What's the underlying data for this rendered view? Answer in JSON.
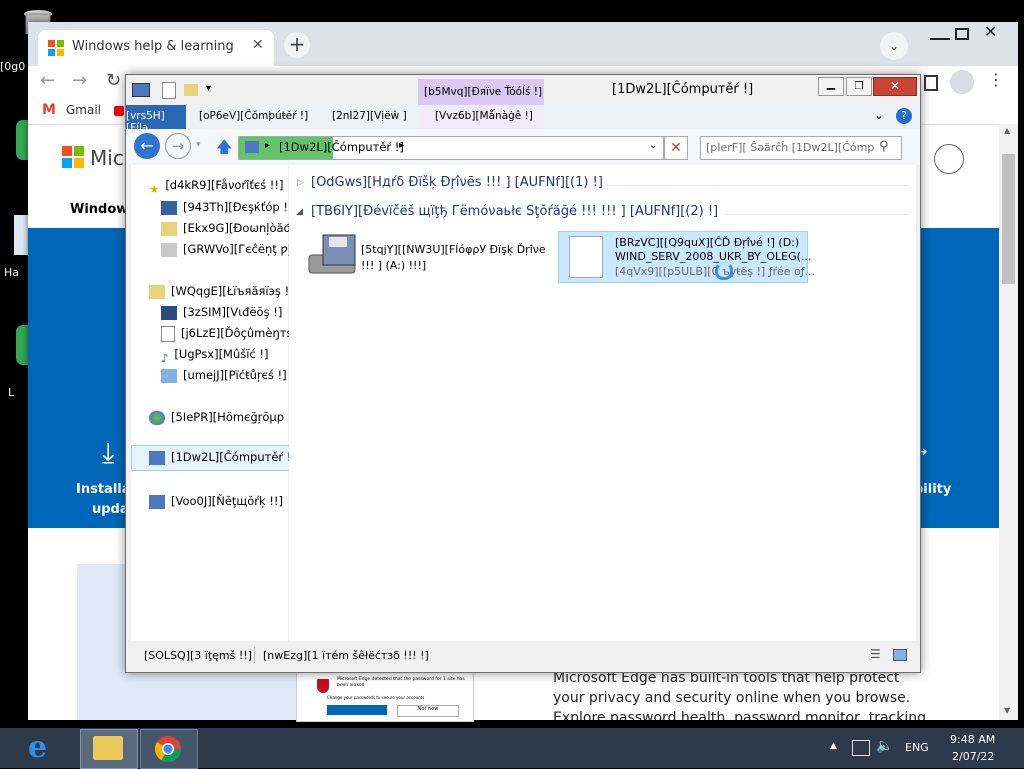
{
  "desktop": {
    "left_labels": [
      "[0g0",
      "Ha",
      "L"
    ]
  },
  "chrome": {
    "tab_title": "Windows help & learning",
    "bookmarks": [
      {
        "label": "Gmail"
      }
    ],
    "page": {
      "brand_partial": "Micr",
      "nav_partial": "Windows",
      "install_line1": "Installat",
      "install_line2": "upda",
      "right_tile": "bility",
      "edge_text": "Microsoft Edge has built-in tools that help protect your privacy and security online when you browse. Explore password health, password monitor, tracking prevention,",
      "edge_thumb_title": "Microsoft Edge detected that the password for 1 site has been leaked",
      "edge_thumb_sub": "Change your passwords to secure your accounts",
      "edge_thumb_btn": "Not now"
    }
  },
  "explorer": {
    "title": "[1Dw2L][Ĉómpuтěŕ !]",
    "ribbon_tabs": [
      {
        "label": "[vrs5H][Fíl϶"
      },
      {
        "label": "[oP6eV][Ĉŏmþúŧĕŕ !]"
      },
      {
        "label": "[2nI27][Vịëŵ ]"
      },
      {
        "label": "[Vvz6b][Mǻnàġê !]"
      }
    ],
    "contextual_tab_group": "[b5Mvq][Ðяïνе Ťóóĺś !]",
    "address": "[1Dw2L][Ĉómpuтěŕ !]",
    "search_placeholder": "[pIerF][ Ŝəărĉĥ [1Dw2L][Ĉómp...",
    "nav": {
      "favorites": "[d4kR9][Fåνоŕîťєś !!]",
      "desktop": "[943Th][Ðєşќťóp !]",
      "downloads": "[Ekx9G][Ðоωnļòăđş",
      "recent": "[GRWVo][Гєĉёņţ ƿļ",
      "libraries": "[WQqgE][Łïъяăяïэş !!]",
      "videos": "[3zSIM][Vιđёŏş !]",
      "documents": "[j6LzE][Ďôçûmèŋтś !",
      "music": "[UgPsx][Mûšïć !]",
      "pictures": "[umejJ][Pїćŧůŗєś !]",
      "homegroup": "[5IePR][Hŏmєğŗŏμр !!]",
      "computer": "[1Dw2L][Ĉómpuтěŕ !]",
      "network": "[Voo0J][Ňĕţщŏŕķ !!]"
    },
    "groups": [
      {
        "label": "[OdGws][Hдŕδ Ðïšķ Ðŗîνēs !!! ] [AUFNf][(1) !]"
      },
      {
        "label": "[TB6IY][Ðévïčëš щïţђ Гёmóνаьłє Sţŏŕăğé !!! !!! ] [AUFNf][(2) !]"
      }
    ],
    "devices": {
      "floppy_line1": "[5tqjY][[NW3U][FĺóφρУ Ðïşķ Ďŗîνе",
      "floppy_line2": "!!! ] (A:) !!!]",
      "cd_line1": "[BRzVC][[Q9quX][ĈĎ Đŗîνé !] (D:)",
      "cd_line2": "WIND_SERV_2008_UKR_BY_OLEG(...",
      "cd_line3": "[4qVx9][[p5ULB][0 ъуŧёş !] ƒŕéе оƒ..."
    },
    "status": {
      "items_count": "[SOLSQ][3 ïţęmš !!]",
      "selected": "[nwEzg][1 ïтém šêłëćтзδ !!! !]"
    }
  },
  "taskbar": {
    "lang": "ENG",
    "time": "9:48 AM",
    "date": "2/07/22"
  },
  "colors": {
    "explorer_selection": "#cce8ff",
    "ms_blue": "#0067b8",
    "taskbar": "#2c3a4c"
  }
}
